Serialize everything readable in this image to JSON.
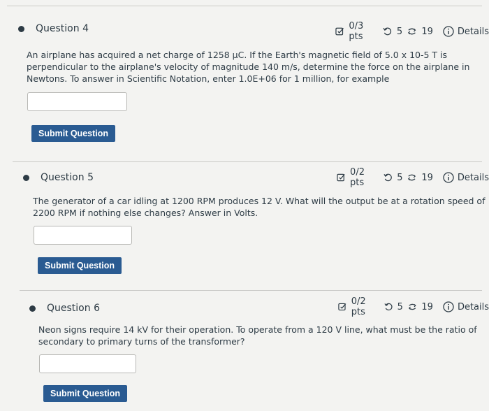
{
  "questions": [
    {
      "title": "Question 4",
      "points": "0/3 pts",
      "retries": "5",
      "attempts": "19",
      "details_label": "Details",
      "text_lines": [
        "An airplane has acquired a net charge of 1258 μC. If the Earth's magnetic field of 5.0 x 10-5 T is",
        "perpendicular to the airplane's velocity of magnitude 140 m/s, determine the force on the airplane in",
        "Newtons. To answer in Scientific Notation, enter 1.0E+06 for 1 million, for example"
      ],
      "answer_value": "",
      "submit_label": "Submit Question"
    },
    {
      "title": "Question 5",
      "points": "0/2 pts",
      "retries": "5",
      "attempts": "19",
      "details_label": "Details",
      "text_lines": [
        "The generator of a car idling at 1200 RPM produces 12 V.  What will the output be at a rotation speed of",
        "2200 RPM if nothing else changes?  Answer in Volts."
      ],
      "answer_value": "",
      "submit_label": "Submit Question"
    },
    {
      "title": "Question 6",
      "points": "0/2 pts",
      "retries": "5",
      "attempts": "19",
      "details_label": "Details",
      "text_lines": [
        "Neon signs require 14 kV for their operation. To operate from a 120 V line, what must be the ratio of",
        "secondary to primary turns of the transformer?"
      ],
      "answer_value": "",
      "submit_label": "Submit Question"
    }
  ],
  "icons": {
    "points": "checkbox-pencil-icon",
    "retries": "undo-icon",
    "attempts": "refresh-icon",
    "details": "info-icon"
  },
  "colors": {
    "accent": "#2a5b92",
    "text": "#2d3b45",
    "background": "#f3f3f1"
  }
}
